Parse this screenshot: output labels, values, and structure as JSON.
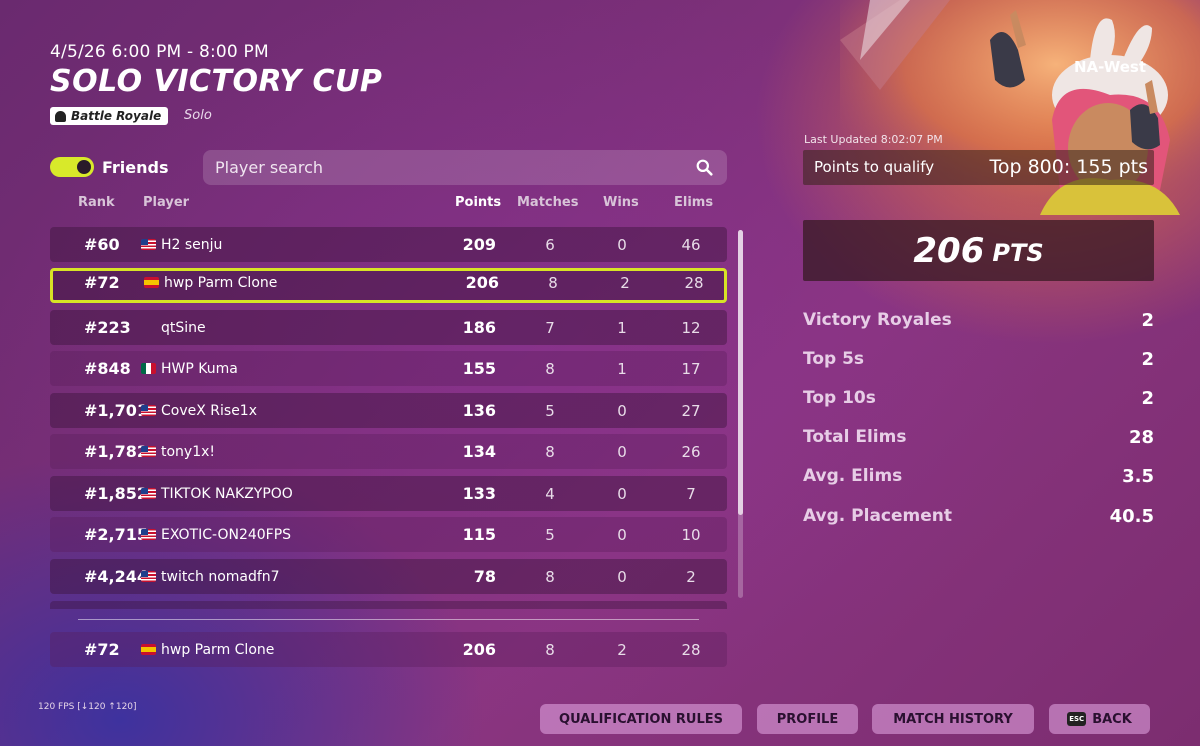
{
  "header": {
    "date": "4/5/26 6:00 PM - 8:00 PM",
    "title": "SOLO VICTORY CUP",
    "mode": "Battle Royale",
    "mode_sub": "Solo"
  },
  "filters": {
    "friends_label": "Friends",
    "friends_on": true,
    "search_placeholder": "Player search"
  },
  "table": {
    "headers": {
      "rank": "Rank",
      "player": "Player",
      "points": "Points",
      "matches": "Matches",
      "wins": "Wins",
      "elims": "Elims"
    },
    "rows": [
      {
        "rank": "#60",
        "flag": "us",
        "player": "H2 senju",
        "points": "209",
        "matches": "6",
        "wins": "0",
        "elims": "46"
      },
      {
        "rank": "#72",
        "flag": "es",
        "player": "hwp Parm Clone",
        "points": "206",
        "matches": "8",
        "wins": "2",
        "elims": "28"
      },
      {
        "rank": "#223",
        "flag": "",
        "player": "qtSine",
        "points": "186",
        "matches": "7",
        "wins": "1",
        "elims": "12"
      },
      {
        "rank": "#848",
        "flag": "mx",
        "player": "HWP Kuma",
        "points": "155",
        "matches": "8",
        "wins": "1",
        "elims": "17"
      },
      {
        "rank": "#1,701",
        "flag": "us",
        "player": "CoveX Rise1x",
        "points": "136",
        "matches": "5",
        "wins": "0",
        "elims": "27"
      },
      {
        "rank": "#1,782",
        "flag": "us",
        "player": "tony1x!",
        "points": "134",
        "matches": "8",
        "wins": "0",
        "elims": "26"
      },
      {
        "rank": "#1,852",
        "flag": "us",
        "player": "TIKTOK NAKZYPOO",
        "points": "133",
        "matches": "4",
        "wins": "0",
        "elims": "7"
      },
      {
        "rank": "#2,715",
        "flag": "us",
        "player": "EXOTIC-ON240FPS",
        "points": "115",
        "matches": "5",
        "wins": "0",
        "elims": "10"
      },
      {
        "rank": "#4,244",
        "flag": "us",
        "player": "twitch nomadfn7",
        "points": "78",
        "matches": "8",
        "wins": "0",
        "elims": "2"
      }
    ],
    "self_row": {
      "rank": "#72",
      "flag": "es",
      "player": "hwp Parm Clone",
      "points": "206",
      "matches": "8",
      "wins": "2",
      "elims": "28"
    }
  },
  "panel": {
    "region": "NA-West",
    "last_updated": "Last Updated 8:02:07 PM",
    "qualify_label": "Points to qualify",
    "qualify_value": "Top 800: 155 pts",
    "points": "206",
    "points_unit": "PTS",
    "stats": [
      {
        "label": "Victory Royales",
        "value": "2"
      },
      {
        "label": "Top 5s",
        "value": "2"
      },
      {
        "label": "Top 10s",
        "value": "2"
      },
      {
        "label": "Total Elims",
        "value": "28"
      },
      {
        "label": "Avg. Elims",
        "value": "3.5"
      },
      {
        "label": "Avg. Placement",
        "value": "40.5"
      }
    ]
  },
  "footer": {
    "fps": "120 FPS [↓120 ↑120]",
    "qualification_rules": "QUALIFICATION RULES",
    "profile": "PROFILE",
    "match_history": "MATCH HISTORY",
    "esc_key": "ESC",
    "back": "BACK"
  },
  "colors": {
    "highlight": "#d7e326",
    "toggle": "#d8e92a"
  }
}
